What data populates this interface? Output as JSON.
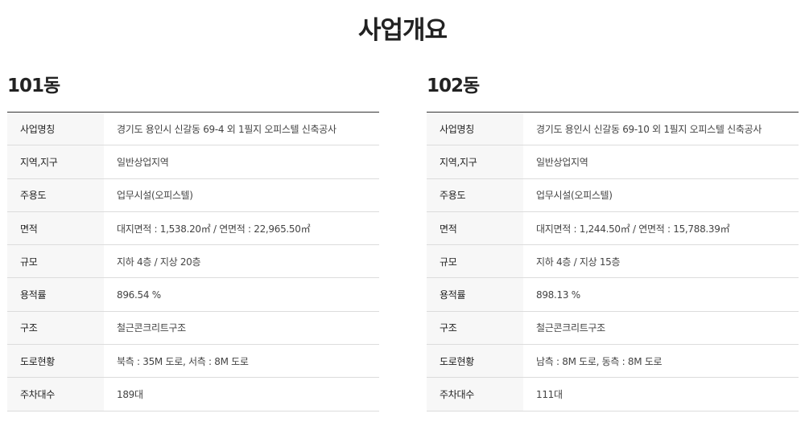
{
  "title": "사업개요",
  "buildings": [
    {
      "name": "101동",
      "rows": [
        {
          "label": "사업명칭",
          "value": "경기도 용인시 신갈동 69-4 외 1필지 오피스텔 신축공사"
        },
        {
          "label": "지역,지구",
          "value": "일반상업지역"
        },
        {
          "label": "주용도",
          "value": "업무시설(오피스텔)"
        },
        {
          "label": "면적",
          "value": "대지면적 : 1,538.20㎡ / 연면적 : 22,965.50㎡"
        },
        {
          "label": "규모",
          "value": "지하 4층 / 지상 20층"
        },
        {
          "label": "용적률",
          "value": "896.54 %"
        },
        {
          "label": "구조",
          "value": "철근콘크리트구조"
        },
        {
          "label": "도로현황",
          "value": "북측 : 35M 도로, 서측 : 8M 도로"
        },
        {
          "label": "주차대수",
          "value": "189대"
        }
      ]
    },
    {
      "name": "102동",
      "rows": [
        {
          "label": "사업명칭",
          "value": "경기도 용인시 신갈동 69-10 외 1필지 오피스텔 신축공사"
        },
        {
          "label": "지역,지구",
          "value": "일반상업지역"
        },
        {
          "label": "주용도",
          "value": "업무시설(오피스텔)"
        },
        {
          "label": "면적",
          "value": "대지면적 : 1,244.50㎡ / 연면적 : 15,788.39㎡"
        },
        {
          "label": "규모",
          "value": "지하 4층 / 지상 15층"
        },
        {
          "label": "용적률",
          "value": "898.13 %"
        },
        {
          "label": "구조",
          "value": "철근콘크리트구조"
        },
        {
          "label": "도로현황",
          "value": "남측 : 8M 도로, 동측 : 8M 도로"
        },
        {
          "label": "주차대수",
          "value": "111대"
        }
      ]
    }
  ]
}
